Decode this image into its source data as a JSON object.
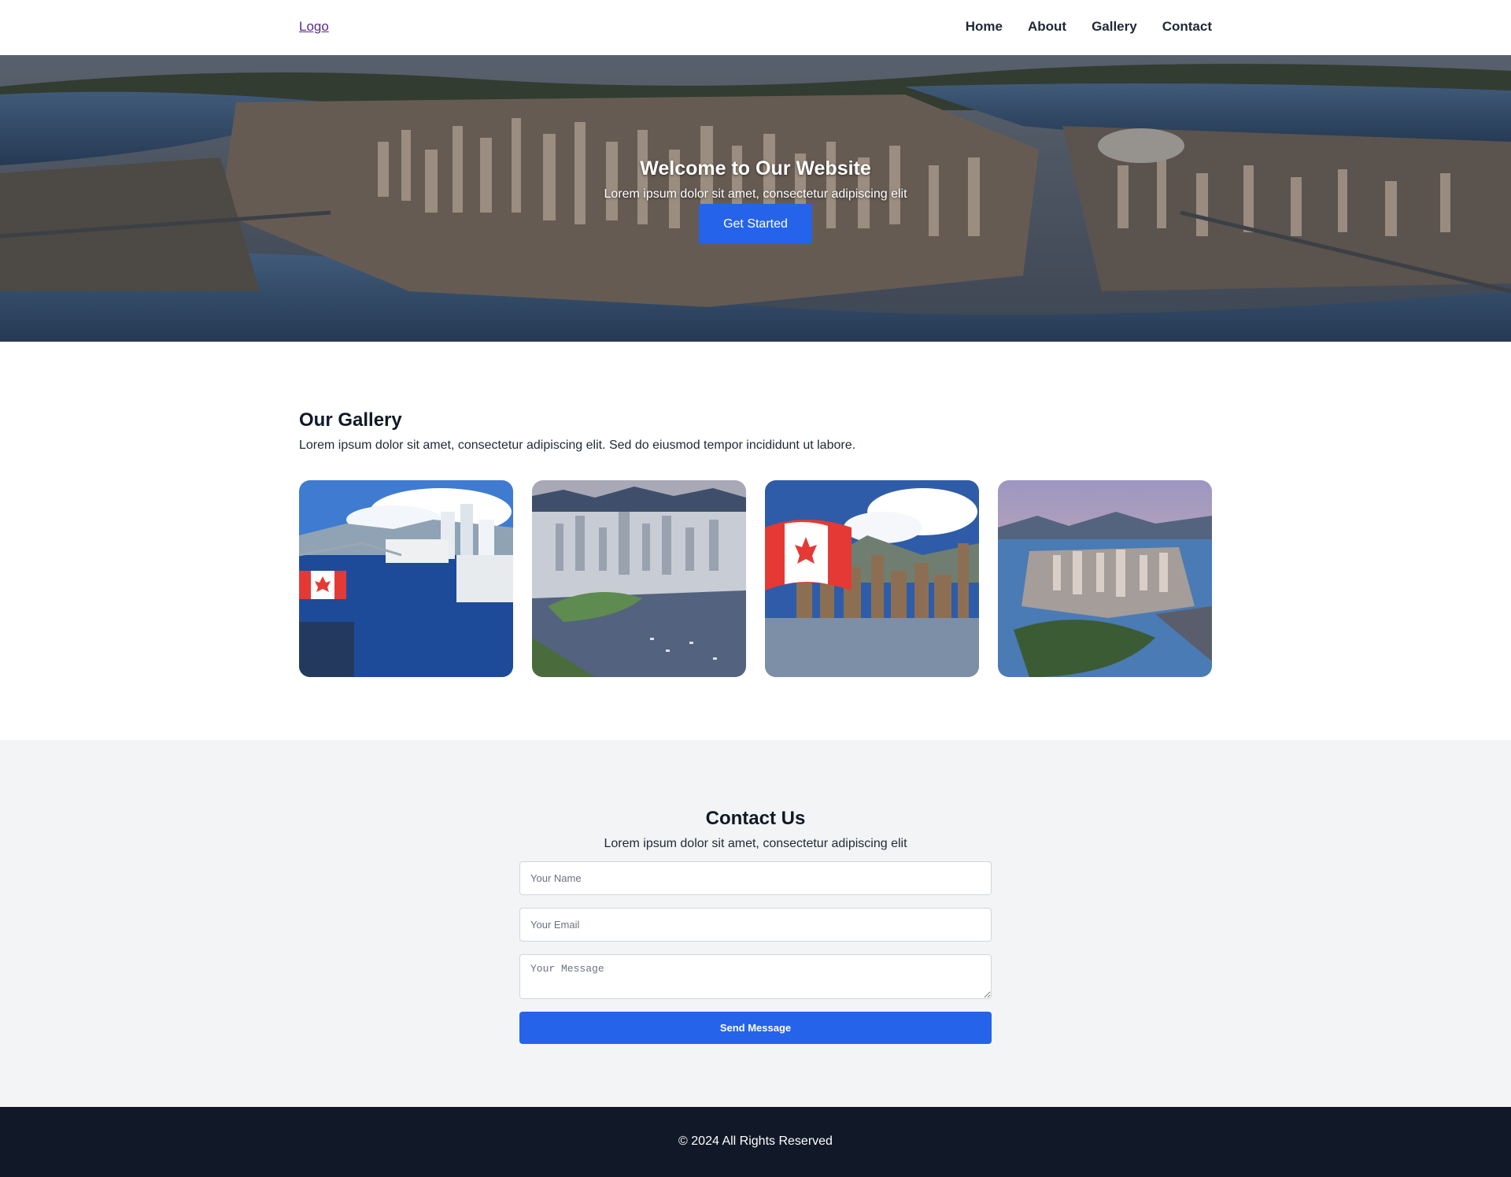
{
  "header": {
    "logo": "Logo",
    "nav": [
      "Home",
      "About",
      "Gallery",
      "Contact"
    ]
  },
  "hero": {
    "title": "Welcome to Our Website",
    "subtitle": "Lorem ipsum dolor sit amet, consectetur adipiscing elit",
    "button": "Get Started"
  },
  "gallery": {
    "title": "Our Gallery",
    "description": "Lorem ipsum dolor sit amet, consectetur adipiscing elit. Sed do eiusmod tempor incididunt ut labore.",
    "images": [
      "vancouver-harbour-canadian-flag-photo",
      "vancouver-downtown-aerial-photo",
      "canadian-flag-city-skyline-photo",
      "vancouver-sunset-aerial-photo"
    ]
  },
  "contact": {
    "title": "Contact Us",
    "subtitle": "Lorem ipsum dolor sit amet, consectetur adipiscing elit",
    "name_placeholder": "Your Name",
    "email_placeholder": "Your Email",
    "message_placeholder": "Your Message",
    "button": "Send Message"
  },
  "footer": {
    "text": "© 2024 All Rights Reserved"
  },
  "colors": {
    "primary": "#2563eb",
    "footer_bg": "#111827",
    "contact_bg": "#f3f4f6"
  }
}
